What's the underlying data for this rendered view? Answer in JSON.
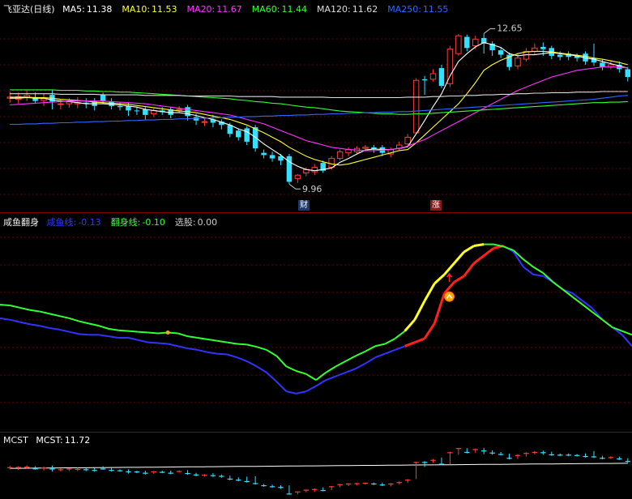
{
  "main": {
    "title": "飞亚达(日线)",
    "ma": [
      {
        "label": "MA5:",
        "value": "11.38",
        "color": "#ffffff"
      },
      {
        "label": "MA10:",
        "value": "11.53",
        "color": "#ffff33"
      },
      {
        "label": "MA20:",
        "value": "11.67",
        "color": "#ff33ff"
      },
      {
        "label": "MA60:",
        "value": "11.44",
        "color": "#33ff33"
      },
      {
        "label": "MA120:",
        "value": "11.62",
        "color": "#dddddd"
      },
      {
        "label": "MA250:",
        "value": "11.55",
        "color": "#3366ff"
      }
    ],
    "high_label": "12.65",
    "low_label": "9.96",
    "badge_left": "财",
    "badge_right": "涨"
  },
  "sub1": {
    "title": "咸鱼翻身",
    "items": [
      {
        "label": "咸鱼线:",
        "value": "-0.13",
        "color": "#3333ff"
      },
      {
        "label": "翻身线:",
        "value": "-0.10",
        "color": "#33ff33"
      },
      {
        "label": "选股:",
        "value": "0.00",
        "color": "#cccccc"
      }
    ]
  },
  "sub2": {
    "title": "MCST",
    "items": [
      {
        "label": "MCST:",
        "value": "11.72",
        "color": "#ffffff"
      }
    ]
  },
  "chart_data": [
    {
      "type": "candlestick",
      "title": "飞亚达(日线)",
      "ylim": [
        9.6,
        13.0
      ],
      "candles": [
        [
          11.5,
          11.52,
          11.62,
          11.42
        ],
        [
          11.48,
          11.53,
          11.6,
          11.4
        ],
        [
          11.52,
          11.55,
          11.65,
          11.45
        ],
        [
          11.52,
          11.45,
          11.6,
          11.4
        ],
        [
          11.46,
          11.49,
          11.58,
          11.36
        ],
        [
          11.56,
          11.44,
          11.64,
          11.3
        ],
        [
          11.4,
          11.4,
          11.48,
          11.3
        ],
        [
          11.4,
          11.44,
          11.5,
          11.33
        ],
        [
          11.4,
          11.42,
          11.52,
          11.32
        ],
        [
          11.42,
          11.4,
          11.5,
          11.32
        ],
        [
          11.44,
          11.36,
          11.5,
          11.28
        ],
        [
          11.56,
          11.44,
          11.6,
          11.4
        ],
        [
          11.44,
          11.36,
          11.5,
          11.3
        ],
        [
          11.36,
          11.34,
          11.42,
          11.28
        ],
        [
          11.36,
          11.28,
          11.42,
          11.18
        ],
        [
          11.28,
          11.27,
          11.34,
          11.2
        ],
        [
          11.3,
          11.2,
          11.34,
          11.12
        ],
        [
          11.22,
          11.28,
          11.32,
          11.16
        ],
        [
          11.28,
          11.25,
          11.34,
          11.2
        ],
        [
          11.3,
          11.2,
          11.34,
          11.14
        ],
        [
          11.3,
          11.3,
          11.36,
          11.24
        ],
        [
          11.34,
          11.18,
          11.38,
          11.1
        ],
        [
          11.16,
          11.1,
          11.22,
          11.02
        ],
        [
          11.08,
          11.08,
          11.14,
          11.0
        ],
        [
          11.12,
          11.06,
          11.2,
          10.98
        ],
        [
          11.08,
          11.02,
          11.12,
          10.94
        ],
        [
          11.02,
          10.86,
          11.06,
          10.8
        ],
        [
          10.92,
          10.8,
          10.96,
          10.74
        ],
        [
          10.96,
          10.72,
          11.0,
          10.66
        ],
        [
          10.98,
          10.6,
          11.02,
          10.54
        ],
        [
          10.52,
          10.48,
          10.58,
          10.42
        ],
        [
          10.48,
          10.42,
          10.54,
          10.36
        ],
        [
          10.46,
          10.38,
          10.5,
          10.3
        ],
        [
          10.46,
          10.0,
          10.5,
          9.96
        ],
        [
          10.06,
          10.12,
          10.14,
          9.98
        ],
        [
          10.16,
          10.22,
          10.26,
          10.1
        ],
        [
          10.18,
          10.26,
          10.32,
          10.12
        ],
        [
          10.34,
          10.2,
          10.38,
          10.16
        ],
        [
          10.26,
          10.42,
          10.46,
          10.22
        ],
        [
          10.42,
          10.54,
          10.58,
          10.38
        ],
        [
          10.52,
          10.58,
          10.62,
          10.46
        ],
        [
          10.54,
          10.6,
          10.64,
          10.5
        ],
        [
          10.6,
          10.62,
          10.66,
          10.54
        ],
        [
          10.62,
          10.58,
          10.66,
          10.52
        ],
        [
          10.62,
          10.52,
          10.66,
          10.46
        ],
        [
          10.5,
          10.58,
          10.62,
          10.44
        ],
        [
          10.6,
          10.66,
          10.72,
          10.56
        ],
        [
          10.68,
          10.8,
          10.86,
          10.64
        ],
        [
          10.88,
          11.82,
          11.86,
          10.86
        ],
        [
          11.84,
          11.82,
          11.9,
          11.56
        ],
        [
          11.84,
          11.94,
          12.02,
          11.8
        ],
        [
          12.04,
          11.72,
          12.1,
          11.68
        ],
        [
          11.76,
          12.38,
          12.44,
          11.7
        ],
        [
          12.3,
          12.62,
          12.65,
          12.26
        ],
        [
          12.6,
          12.4,
          12.64,
          12.34
        ],
        [
          12.44,
          12.56,
          12.62,
          12.38
        ],
        [
          12.58,
          12.48,
          12.66,
          12.3
        ],
        [
          12.48,
          12.36,
          12.52,
          12.26
        ],
        [
          12.36,
          12.28,
          12.42,
          12.22
        ],
        [
          12.28,
          12.06,
          12.32,
          12.0
        ],
        [
          12.08,
          12.22,
          12.3,
          12.02
        ],
        [
          12.2,
          12.34,
          12.4,
          12.16
        ],
        [
          12.34,
          12.4,
          12.48,
          12.28
        ],
        [
          12.42,
          12.38,
          12.5,
          12.26
        ],
        [
          12.4,
          12.26,
          12.44,
          12.2
        ],
        [
          12.28,
          12.24,
          12.34,
          12.18
        ],
        [
          12.3,
          12.24,
          12.34,
          12.18
        ],
        [
          12.26,
          12.22,
          12.3,
          12.16
        ],
        [
          12.3,
          12.16,
          12.34,
          12.1
        ],
        [
          12.22,
          12.14,
          12.48,
          12.08
        ],
        [
          12.14,
          12.06,
          12.2,
          12.0
        ],
        [
          12.06,
          12.1,
          12.18,
          12.02
        ],
        [
          12.1,
          12.02,
          12.16,
          11.96
        ],
        [
          12.02,
          11.88,
          12.06,
          11.8
        ]
      ],
      "ma_series": [
        {
          "name": "MA5",
          "color": "#ffffff",
          "values": [
            11.5,
            11.5,
            11.51,
            11.5,
            11.5,
            11.47,
            11.45,
            11.44,
            11.42,
            11.4,
            11.4,
            11.4,
            11.39,
            11.38,
            11.36,
            11.34,
            11.3,
            11.28,
            11.26,
            11.24,
            11.24,
            11.22,
            11.19,
            11.15,
            11.12,
            11.07,
            11.02,
            10.95,
            10.9,
            10.8,
            10.68,
            10.58,
            10.48,
            10.36,
            10.28,
            10.22,
            10.2,
            10.22,
            10.25,
            10.35,
            10.42,
            10.5,
            10.57,
            10.59,
            10.58,
            10.58,
            10.6,
            10.63,
            10.86,
            11.1,
            11.35,
            11.58,
            11.9,
            12.16,
            12.3,
            12.42,
            12.5,
            12.46,
            12.41,
            12.3,
            12.26,
            12.28,
            12.28,
            12.3,
            12.32,
            12.3,
            12.28,
            12.26,
            12.22,
            12.2,
            12.16,
            12.12,
            12.08,
            12.04
          ]
        },
        {
          "name": "MA10",
          "color": "#ffff33",
          "values": [
            11.52,
            11.52,
            11.52,
            11.51,
            11.51,
            11.5,
            11.48,
            11.47,
            11.46,
            11.45,
            11.43,
            11.42,
            11.41,
            11.4,
            11.39,
            11.37,
            11.35,
            11.33,
            11.31,
            11.29,
            11.27,
            11.26,
            11.24,
            11.21,
            11.18,
            11.15,
            11.12,
            11.07,
            11.02,
            10.95,
            10.88,
            10.8,
            10.72,
            10.62,
            10.54,
            10.46,
            10.4,
            10.36,
            10.32,
            10.3,
            10.32,
            10.36,
            10.4,
            10.44,
            10.48,
            10.52,
            10.56,
            10.58,
            10.7,
            10.84,
            10.98,
            11.12,
            11.26,
            11.4,
            11.58,
            11.78,
            12.0,
            12.1,
            12.18,
            12.24,
            12.3,
            12.33,
            12.34,
            12.34,
            12.33,
            12.31,
            12.29,
            12.27,
            12.25,
            12.22,
            12.2,
            12.17,
            12.14,
            12.1
          ]
        },
        {
          "name": "MA20",
          "color": "#ff33ff",
          "values": [
            11.38,
            11.39,
            11.4,
            11.41,
            11.42,
            11.43,
            11.44,
            11.45,
            11.45,
            11.45,
            11.45,
            11.45,
            11.44,
            11.43,
            11.42,
            11.41,
            11.4,
            11.38,
            11.36,
            11.34,
            11.32,
            11.3,
            11.28,
            11.26,
            11.24,
            11.22,
            11.2,
            11.16,
            11.12,
            11.08,
            11.04,
            10.98,
            10.92,
            10.86,
            10.8,
            10.74,
            10.7,
            10.66,
            10.62,
            10.6,
            10.58,
            10.57,
            10.56,
            10.56,
            10.57,
            10.58,
            10.6,
            10.64,
            10.7,
            10.76,
            10.84,
            10.92,
            11.0,
            11.08,
            11.16,
            11.24,
            11.32,
            11.4,
            11.48,
            11.56,
            11.64,
            11.7,
            11.76,
            11.82,
            11.88,
            11.92,
            11.96,
            12.0,
            12.02,
            12.04,
            12.06,
            12.06,
            12.06,
            12.04
          ]
        },
        {
          "name": "MA60",
          "color": "#33ff33",
          "values": [
            11.65,
            11.65,
            11.65,
            11.65,
            11.65,
            11.65,
            11.64,
            11.64,
            11.64,
            11.63,
            11.63,
            11.62,
            11.62,
            11.61,
            11.61,
            11.6,
            11.59,
            11.58,
            11.57,
            11.56,
            11.55,
            11.54,
            11.53,
            11.52,
            11.51,
            11.5,
            11.49,
            11.47,
            11.46,
            11.44,
            11.43,
            11.41,
            11.4,
            11.38,
            11.36,
            11.34,
            11.33,
            11.31,
            11.29,
            11.27,
            11.26,
            11.25,
            11.24,
            11.23,
            11.22,
            11.22,
            11.21,
            11.21,
            11.22,
            11.22,
            11.23,
            11.24,
            11.25,
            11.26,
            11.27,
            11.28,
            11.29,
            11.3,
            11.31,
            11.32,
            11.33,
            11.34,
            11.35,
            11.36,
            11.37,
            11.38,
            11.39,
            11.4,
            11.41,
            11.42,
            11.42,
            11.43,
            11.43,
            11.44
          ]
        },
        {
          "name": "MA120",
          "color": "#dddddd",
          "values": [
            11.58,
            11.58,
            11.58,
            11.58,
            11.58,
            11.58,
            11.57,
            11.57,
            11.57,
            11.57,
            11.57,
            11.56,
            11.56,
            11.56,
            11.56,
            11.56,
            11.55,
            11.55,
            11.55,
            11.55,
            11.55,
            11.54,
            11.54,
            11.54,
            11.54,
            11.54,
            11.54,
            11.53,
            11.53,
            11.53,
            11.53,
            11.53,
            11.52,
            11.52,
            11.52,
            11.52,
            11.52,
            11.52,
            11.51,
            11.51,
            11.51,
            11.51,
            11.51,
            11.51,
            11.51,
            11.51,
            11.51,
            11.52,
            11.52,
            11.52,
            11.53,
            11.53,
            11.54,
            11.54,
            11.55,
            11.55,
            11.56,
            11.56,
            11.57,
            11.57,
            11.58,
            11.58,
            11.59,
            11.59,
            11.6,
            11.6,
            11.6,
            11.61,
            11.61,
            11.61,
            11.62,
            11.62,
            11.62,
            11.62
          ]
        },
        {
          "name": "MA250",
          "color": "#3366ff",
          "values": [
            11.03,
            11.03,
            11.04,
            11.04,
            11.05,
            11.05,
            11.06,
            11.06,
            11.07,
            11.07,
            11.08,
            11.08,
            11.09,
            11.09,
            11.1,
            11.1,
            11.11,
            11.11,
            11.12,
            11.12,
            11.13,
            11.13,
            11.14,
            11.14,
            11.15,
            11.15,
            11.16,
            11.16,
            11.17,
            11.17,
            11.18,
            11.18,
            11.19,
            11.19,
            11.2,
            11.2,
            11.21,
            11.21,
            11.22,
            11.22,
            11.23,
            11.23,
            11.24,
            11.24,
            11.25,
            11.25,
            11.26,
            11.26,
            11.27,
            11.28,
            11.29,
            11.3,
            11.31,
            11.32,
            11.33,
            11.34,
            11.35,
            11.36,
            11.37,
            11.38,
            11.39,
            11.4,
            11.41,
            11.42,
            11.43,
            11.44,
            11.45,
            11.46,
            11.47,
            11.48,
            11.5,
            11.52,
            11.54,
            11.55
          ]
        }
      ]
    },
    {
      "type": "line",
      "title": "咸鱼翻身",
      "ylim": [
        -1.3,
        1.3
      ],
      "series": [
        {
          "name": "咸鱼线",
          "color": "#3333ff",
          "values": [
            0.12,
            0.1,
            0.07,
            0.04,
            0.02,
            -0.01,
            -0.03,
            -0.06,
            -0.09,
            -0.1,
            -0.1,
            -0.12,
            -0.14,
            -0.14,
            -0.17,
            -0.2,
            -0.21,
            -0.22,
            -0.25,
            -0.28,
            -0.3,
            -0.33,
            -0.35,
            -0.36,
            -0.4,
            -0.45,
            -0.52,
            -0.6,
            -0.72,
            -0.85,
            -0.88,
            -0.85,
            -0.78,
            -0.7,
            -0.65,
            -0.6,
            -0.55,
            -0.48,
            -0.4,
            -0.35,
            -0.3,
            -0.25,
            -0.2,
            -0.15,
            0.05,
            0.45,
            0.6,
            0.68,
            0.85,
            0.95,
            1.05,
            1.08,
            1.0,
            0.8,
            0.7,
            0.68,
            0.6,
            0.5,
            0.45,
            0.35,
            0.25,
            0.1,
            0.0,
            -0.1,
            -0.25
          ]
        },
        {
          "name": "翻身线",
          "color": "#33ff33",
          "values": [
            0.3,
            0.29,
            0.26,
            0.23,
            0.21,
            0.18,
            0.15,
            0.12,
            0.08,
            0.05,
            0.02,
            -0.02,
            -0.04,
            -0.05,
            -0.06,
            -0.07,
            -0.08,
            -0.07,
            -0.08,
            -0.12,
            -0.14,
            -0.16,
            -0.18,
            -0.2,
            -0.22,
            -0.23,
            -0.26,
            -0.3,
            -0.38,
            -0.52,
            -0.58,
            -0.62,
            -0.7,
            -0.6,
            -0.52,
            -0.45,
            -0.38,
            -0.32,
            -0.25,
            -0.22,
            -0.15,
            -0.05,
            0.1,
            0.35,
            0.58,
            0.7,
            0.85,
            1.0,
            1.08,
            1.1,
            1.1,
            1.07,
            1.02,
            0.9,
            0.8,
            0.72,
            0.6,
            0.5,
            0.4,
            0.3,
            0.2,
            0.1,
            0.0,
            -0.05,
            -0.1
          ]
        }
      ]
    },
    {
      "type": "candlestick",
      "title": "MCST",
      "series": [
        {
          "name": "MCST",
          "color": "#ffffff"
        }
      ]
    }
  ]
}
